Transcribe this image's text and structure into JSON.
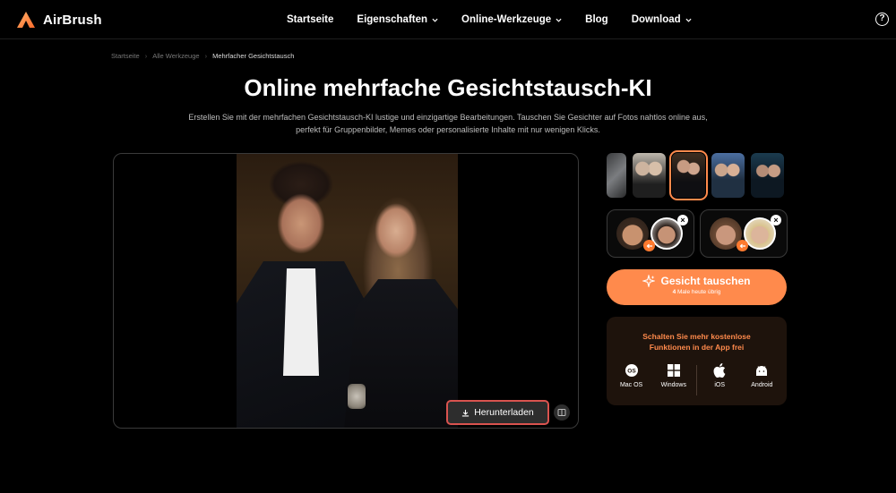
{
  "brand": {
    "name": "AirBrush"
  },
  "nav": {
    "items": [
      {
        "label": "Startseite"
      },
      {
        "label": "Eigenschaften"
      },
      {
        "label": "Online-Werkzeuge"
      },
      {
        "label": "Blog"
      },
      {
        "label": "Download"
      }
    ],
    "help": "?"
  },
  "breadcrumb": [
    "Startseite",
    "Alle Werkzeuge",
    "Mehrfacher Gesichtstausch"
  ],
  "page": {
    "title": "Online mehrfache Gesichtstausch-KI",
    "subtitle_line1": "Erstellen Sie mit der mehrfachen Gesichtstausch-KI lustige und einzigartige Bearbeitungen. Tauschen Sie Gesichter auf Fotos nahtlos online aus,",
    "subtitle_line2": "perfekt für Gruppenbilder, Memes oder personalisierte Inhalte mit nur wenigen Klicks."
  },
  "editor": {
    "download_label": "Herunterladen"
  },
  "swap": {
    "button_label": "Gesicht tauschen",
    "count": "4",
    "count_suffix": "Male heute übrig"
  },
  "app_promo": {
    "line1": "Schalten Sie mehr kostenlose",
    "line2": "Funktionen in der App frei",
    "platforms": [
      {
        "label": "Mac OS",
        "icon": "macos-icon"
      },
      {
        "label": "Windows",
        "icon": "windows-icon"
      },
      {
        "label": "iOS",
        "icon": "apple-icon"
      },
      {
        "label": "Android",
        "icon": "android-icon"
      }
    ]
  },
  "colors": {
    "accent": "#ff8a4c",
    "highlight": "#d9534f",
    "background": "#000000"
  }
}
